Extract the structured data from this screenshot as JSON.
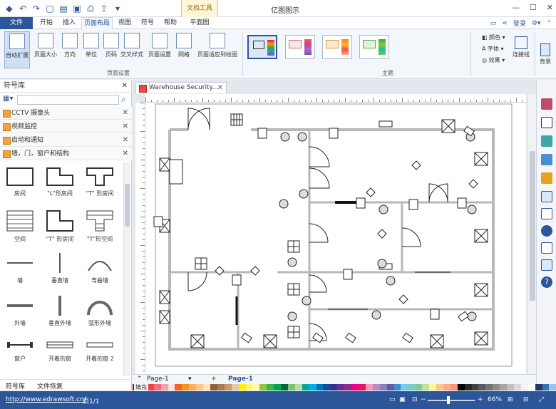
{
  "app": {
    "title": "亿图图示",
    "context_tab": "文档工具"
  },
  "ribbon_tabs": [
    "文件",
    "开始",
    "插入",
    "页面布局",
    "视图",
    "符号",
    "帮助",
    "平面图"
  ],
  "account": {
    "login": "登录"
  },
  "ribbon": {
    "page_setup_buttons": [
      "自动扩展",
      "页面大小",
      "方向",
      "单位",
      "页码",
      "交叉样式",
      "页面设置",
      "网格",
      "页面适应到绘图"
    ],
    "page_setup_group": "页面设置",
    "theme_group": "主题",
    "style_items": [
      "颜色",
      "字体",
      "效果"
    ],
    "connector": "连接线",
    "background": "背景"
  },
  "library": {
    "title": "符号库",
    "categories": [
      "CCTV 摄像头",
      "视频监控",
      "启动和通知",
      "墙，门，窗户和结构"
    ],
    "shapes": [
      "房间",
      "\"L\"形房间",
      "\"T\" 形房间",
      "空间",
      "\"T\" 形房间",
      "\"T\"形空间",
      "墙",
      "垂直墙",
      "弯曲墙",
      "外墙",
      "垂直外墙",
      "弧形外墙",
      "窗户",
      "开着的窗",
      "开着的窗 2"
    ],
    "bottom_tabs": [
      "符号库",
      "文件恢复"
    ]
  },
  "document": {
    "tab": "Warehouse Security..."
  },
  "pages": {
    "current": "Page-1",
    "tab": "Page-1",
    "fill_label": "填充"
  },
  "status": {
    "url": "http://www.edrawsoft.cn/",
    "page": "页1/1",
    "zoom": "66%"
  },
  "colors": {
    "accent": "#2b579a",
    "wall": "#b8b8b8",
    "ink": "#222222"
  }
}
